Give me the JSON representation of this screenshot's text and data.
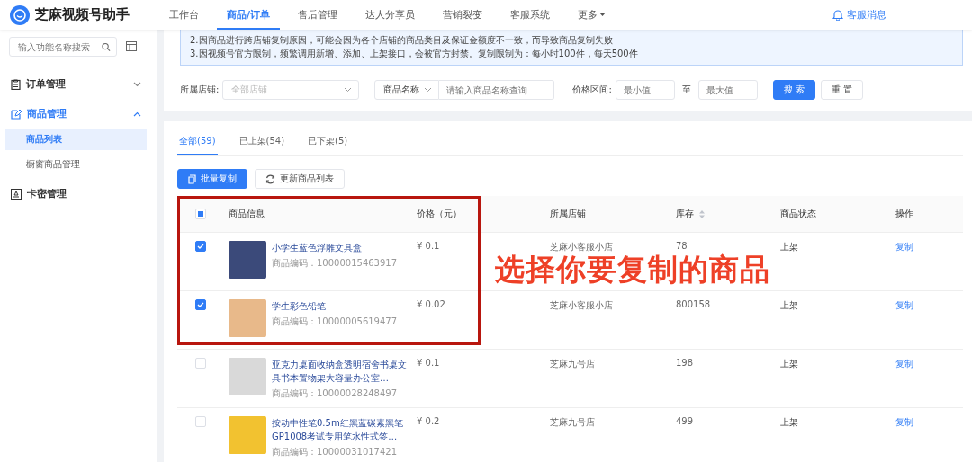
{
  "app": {
    "title": "芝麻视频号助手"
  },
  "nav": [
    {
      "label": "工作台",
      "selected": false
    },
    {
      "label": "商品/订单",
      "selected": true
    },
    {
      "label": "售后管理",
      "selected": false
    },
    {
      "label": "达人分享员",
      "selected": false
    },
    {
      "label": "营销裂变",
      "selected": false
    },
    {
      "label": "客服系统",
      "selected": false
    },
    {
      "label": "更多",
      "selected": false,
      "kind": "dropdown"
    }
  ],
  "notification": {
    "label": "客服消息"
  },
  "sidebar": {
    "search": {
      "placeholder": "输入功能名称搜索"
    },
    "items": [
      {
        "label": "订单管理",
        "kind": "group",
        "expanded": false
      },
      {
        "label": "商品管理",
        "kind": "group",
        "expanded": true,
        "children": [
          {
            "label": "商品列表",
            "selected": true
          },
          {
            "label": "橱窗商品管理",
            "selected": false
          }
        ]
      },
      {
        "label": "卡密管理",
        "kind": "link"
      }
    ]
  },
  "notice": [
    "2.因商品进行跨店铺复制原因，可能会因为各个店铺的商品类目及保证金额度不一致，而导致商品复制失败",
    "3.因视频号官方限制，频繁调用新增、添加、上架接口，会被官方封禁。复制限制为：每小时100件，每天500件"
  ],
  "filters": {
    "store_label": "所属店铺:",
    "store_placeholder": "全部店铺",
    "name_select": "商品名称",
    "name_placeholder": "请输入商品名称查询",
    "price_label": "价格区间:",
    "min_placeholder": "最小值",
    "to": "至",
    "max_placeholder": "最大值",
    "search_button": "搜 索",
    "reset_button": "重 置"
  },
  "tabs": [
    {
      "label": "全部(59)",
      "selected": true
    },
    {
      "label": "已上架(54)",
      "selected": false
    },
    {
      "label": "已下架(5)",
      "selected": false
    }
  ],
  "actions": {
    "batch_copy": "批量复制",
    "refresh": "更新商品列表"
  },
  "table": {
    "select_all": {
      "checked": false,
      "indeterminate": true
    },
    "columns": [
      "商品信息",
      "价格（元）",
      "所属店铺",
      "库存",
      "商品状态",
      "操作"
    ],
    "rows": [
      {
        "checked": true,
        "name": "小学生蓝色浮雕文具盒",
        "code": "商品编码：10000015463917",
        "price": "¥ 0.1",
        "store": "芝麻小客服小店",
        "stock": "78",
        "status": "上架",
        "action": "复制"
      },
      {
        "checked": true,
        "name": "学生彩色铅笔",
        "code": "商品编码：10000005619477",
        "price": "¥ 0.02",
        "store": "芝麻小客服小店",
        "stock": "800158",
        "status": "上架",
        "action": "复制"
      },
      {
        "checked": false,
        "name": "亚克力桌面收纳盒透明宿舍书桌文具书本置物架大容量办公室…",
        "code": "商品编码：10000028248497",
        "price": "¥ 0.1",
        "store": "芝麻九号店",
        "stock": "198",
        "status": "上架",
        "action": "复制"
      },
      {
        "checked": false,
        "name": "按动中性笔0.5m红黑蓝碳素黑笔GP1008考试专用笔水性式签…",
        "code": "商品编码：10000031017421",
        "price": "¥ 0.2",
        "store": "芝麻九号店",
        "stock": "499",
        "status": "上架",
        "action": "复制"
      }
    ]
  },
  "annotation": {
    "text": "选择你要复制的商品"
  }
}
